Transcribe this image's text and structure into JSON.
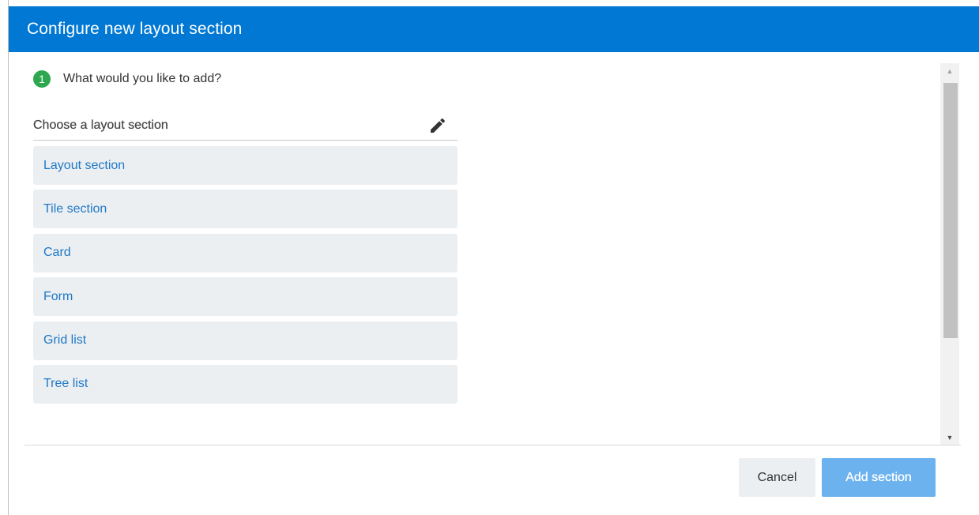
{
  "dialog": {
    "title": "Configure new layout section"
  },
  "step": {
    "number": "1",
    "question": "What would you like to add?"
  },
  "section_picker": {
    "header": "Choose a layout section",
    "edit_icon": "pencil-icon",
    "options": [
      {
        "label": "Layout section"
      },
      {
        "label": "Tile section"
      },
      {
        "label": "Card"
      },
      {
        "label": "Form"
      },
      {
        "label": "Grid list"
      },
      {
        "label": "Tree list"
      }
    ]
  },
  "footer": {
    "cancel_label": "Cancel",
    "add_label": "Add section"
  },
  "colors": {
    "header_bg": "#0078d4",
    "step_badge": "#2ea84f",
    "option_text": "#1e78c8",
    "option_bg": "#eceff1",
    "primary_button_disabled": "#6bb2ee"
  }
}
